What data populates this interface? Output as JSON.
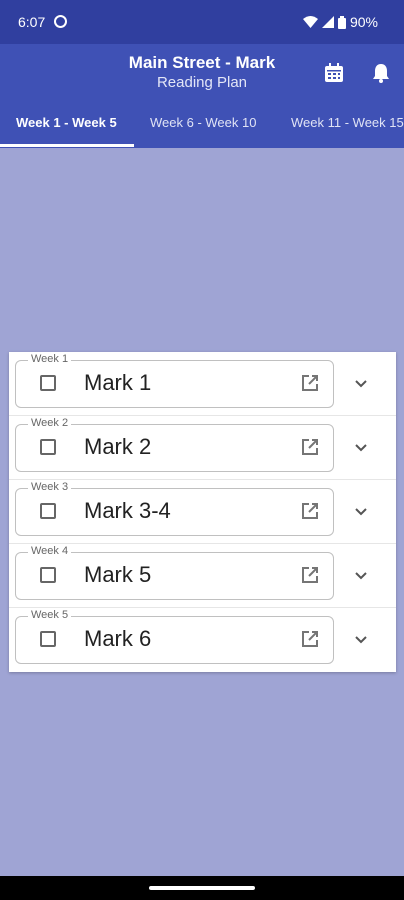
{
  "status_bar": {
    "time": "6:07",
    "battery": "90%"
  },
  "app_bar": {
    "title": "Main Street - Mark",
    "subtitle": "Reading Plan"
  },
  "tabs": [
    {
      "label": "Week 1 - Week 5",
      "active": true
    },
    {
      "label": "Week 6 - Week 10",
      "active": false
    },
    {
      "label": "Week 11 - Week 15",
      "active": false
    }
  ],
  "rows": [
    {
      "week": "Week 1",
      "reading": "Mark 1"
    },
    {
      "week": "Week 2",
      "reading": "Mark 2"
    },
    {
      "week": "Week 3",
      "reading": "Mark 3-4"
    },
    {
      "week": "Week 4",
      "reading": "Mark 5"
    },
    {
      "week": "Week 5",
      "reading": "Mark 6"
    }
  ],
  "colors": {
    "primary": "#3f51b5",
    "status": "#303f9f",
    "background": "#9fa4d4"
  },
  "icons": [
    "calendar-icon",
    "bell-icon",
    "open-external-icon",
    "chevron-down-icon",
    "checkbox-icon"
  ]
}
